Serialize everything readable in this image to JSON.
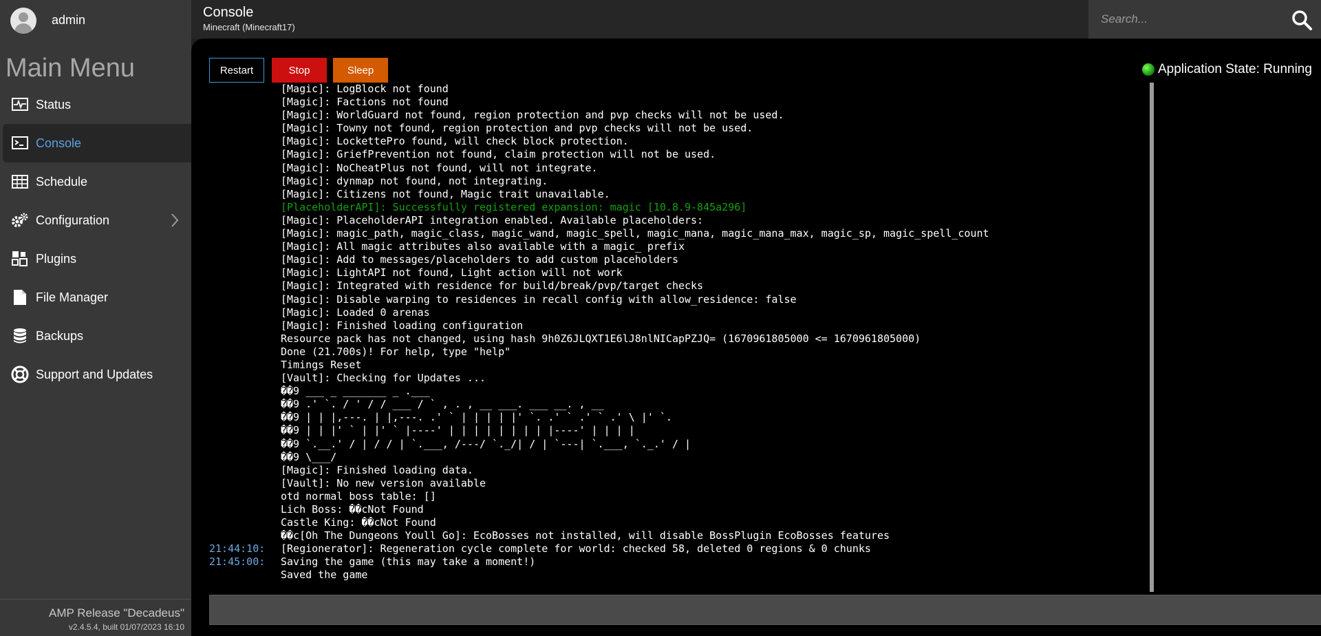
{
  "user": {
    "name": "admin"
  },
  "header": {
    "title": "Console",
    "subtitle": "Minecraft (Minecraft17)"
  },
  "search": {
    "placeholder": "Search..."
  },
  "sidebar": {
    "heading": "Main Menu",
    "items": [
      {
        "label": "Status",
        "icon": "status-icon"
      },
      {
        "label": "Console",
        "icon": "console-icon",
        "active": true
      },
      {
        "label": "Schedule",
        "icon": "schedule-icon"
      },
      {
        "label": "Configuration",
        "icon": "gears-icon",
        "has_submenu": true
      },
      {
        "label": "Plugins",
        "icon": "plugins-icon"
      },
      {
        "label": "File Manager",
        "icon": "file-icon"
      },
      {
        "label": "Backups",
        "icon": "database-icon"
      },
      {
        "label": "Support and Updates",
        "icon": "lifebuoy-icon"
      }
    ],
    "release_name": "AMP Release \"Decadeus\"",
    "release_version": "v2.4.5.4, built 01/07/2023 16:10"
  },
  "toolbar": {
    "restart_label": "Restart",
    "stop_label": "Stop",
    "sleep_label": "Sleep"
  },
  "app_state": {
    "label": "Application State: Running",
    "status_color": "#1a9a10"
  },
  "console": {
    "lines": [
      {
        "ts": "",
        "text": "[Magic]: LogBlock not found"
      },
      {
        "ts": "",
        "text": "[Magic]: Factions not found"
      },
      {
        "ts": "",
        "text": "[Magic]: WorldGuard not found, region protection and pvp checks will not be used."
      },
      {
        "ts": "",
        "text": "[Magic]: Towny not found, region protection and pvp checks will not be used."
      },
      {
        "ts": "",
        "text": "[Magic]: LockettePro found, will check block protection."
      },
      {
        "ts": "",
        "text": "[Magic]: GriefPrevention not found, claim protection will not be used."
      },
      {
        "ts": "",
        "text": "[Magic]: NoCheatPlus not found, will not integrate."
      },
      {
        "ts": "",
        "text": "[Magic]: dynmap not found, not integrating."
      },
      {
        "ts": "",
        "text": "[Magic]: Citizens not found, Magic trait unavailable."
      },
      {
        "ts": "",
        "text": "[PlaceholderAPI]: Successfully registered expansion: magic [10.8.9-845a296]",
        "color": "green"
      },
      {
        "ts": "",
        "text": "[Magic]: PlaceholderAPI integration enabled. Available placeholders:"
      },
      {
        "ts": "",
        "text": "[Magic]: magic_path, magic_class, magic_wand, magic_spell, magic_mana, magic_mana_max, magic_sp, magic_spell_count"
      },
      {
        "ts": "",
        "text": "[Magic]: All magic attributes also available with a magic_ prefix"
      },
      {
        "ts": "",
        "text": "[Magic]: Add to messages/placeholders to add custom placeholders"
      },
      {
        "ts": "",
        "text": "[Magic]: LightAPI not found, Light action will not work"
      },
      {
        "ts": "",
        "text": "[Magic]: Integrated with residence for build/break/pvp/target checks"
      },
      {
        "ts": "",
        "text": "[Magic]: Disable warping to residences in recall config with allow_residence: false"
      },
      {
        "ts": "",
        "text": "[Magic]: Loaded 0 arenas"
      },
      {
        "ts": "",
        "text": "[Magic]: Finished loading configuration"
      },
      {
        "ts": "",
        "text": "Resource pack has not changed, using hash 9h0Z6JLQXT1E6lJ8nlNICapPZJQ= (1670961805000 <= 1670961805000)"
      },
      {
        "ts": "",
        "text": "Done (21.700s)! For help, type \"help\""
      },
      {
        "ts": "",
        "text": "Timings Reset"
      },
      {
        "ts": "",
        "text": "[Vault]: Checking for Updates ..."
      },
      {
        "ts": "",
        "text": "��9 ___ _ _______ _ .___"
      },
      {
        "ts": "",
        "text": "��9 .' `. / ' / / ___ / ` , . , __ ___. ___ __. , __"
      },
      {
        "ts": "",
        "text": "��9 | | |,---. | |,---. .' ` | | | | |' `. .' ` .' ` .' \\ |' `."
      },
      {
        "ts": "",
        "text": "��9 | | |' ` | |' ` |----' | | | | | | | | |----' | | | |"
      },
      {
        "ts": "",
        "text": "��9 `.__.' / | / / | `.___, /---/ `._/| / | `---| `.___, `._.' / |"
      },
      {
        "ts": "",
        "text": "��9 \\___/"
      },
      {
        "ts": "",
        "text": "[Magic]: Finished loading data."
      },
      {
        "ts": "",
        "text": "[Vault]: No new version available"
      },
      {
        "ts": "",
        "text": "otd normal boss table: []"
      },
      {
        "ts": "",
        "text": "Lich Boss: ��cNot Found"
      },
      {
        "ts": "",
        "text": "Castle King: ��cNot Found"
      },
      {
        "ts": "",
        "text": "��c[Oh The Dungeons Youll Go]: EcoBosses not installed, will disable BossPlugin EcoBosses features"
      },
      {
        "ts": "21:44:10:",
        "text": "[Regionerator]: Regeneration cycle complete for world: checked 58, deleted 0 regions & 0 chunks"
      },
      {
        "ts": "21:45:00:",
        "text": "Saving the game (this may take a moment!)"
      },
      {
        "ts": "",
        "text": "Saved the game"
      }
    ],
    "input_value": ""
  }
}
